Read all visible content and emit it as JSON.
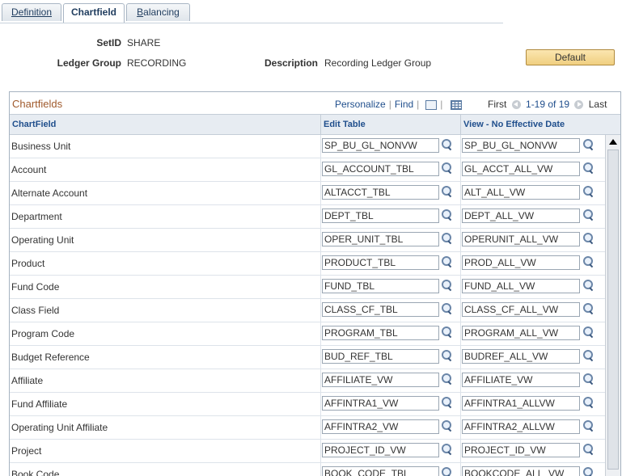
{
  "tabs": [
    {
      "label": "Definition",
      "active": false
    },
    {
      "label": "Chartfield",
      "active": true
    },
    {
      "label": "B",
      "label_rest": "alancing",
      "active": false
    }
  ],
  "header": {
    "setid_label": "SetID",
    "setid_value": "SHARE",
    "ledger_group_label": "Ledger Group",
    "ledger_group_value": "RECORDING",
    "description_label": "Description",
    "description_value": "Recording Ledger Group",
    "default_button": "Default"
  },
  "grid": {
    "title": "Chartfields",
    "personalize": "Personalize",
    "find": "Find",
    "first": "First",
    "count": "1-19 of 19",
    "last": "Last",
    "columns": [
      "ChartField",
      "Edit Table",
      "View - No Effective Date"
    ],
    "rows": [
      {
        "name": "Business Unit",
        "edit": "SP_BU_GL_NONVW",
        "view": "SP_BU_GL_NONVW"
      },
      {
        "name": "Account",
        "edit": "GL_ACCOUNT_TBL",
        "view": "GL_ACCT_ALL_VW"
      },
      {
        "name": "Alternate Account",
        "edit": "ALTACCT_TBL",
        "view": "ALT_ALL_VW"
      },
      {
        "name": "Department",
        "edit": "DEPT_TBL",
        "view": "DEPT_ALL_VW"
      },
      {
        "name": "Operating Unit",
        "edit": "OPER_UNIT_TBL",
        "view": "OPERUNIT_ALL_VW"
      },
      {
        "name": "Product",
        "edit": "PRODUCT_TBL",
        "view": "PROD_ALL_VW"
      },
      {
        "name": "Fund Code",
        "edit": "FUND_TBL",
        "view": "FUND_ALL_VW"
      },
      {
        "name": "Class Field",
        "edit": "CLASS_CF_TBL",
        "view": "CLASS_CF_ALL_VW"
      },
      {
        "name": "Program Code",
        "edit": "PROGRAM_TBL",
        "view": "PROGRAM_ALL_VW"
      },
      {
        "name": "Budget Reference",
        "edit": "BUD_REF_TBL",
        "view": "BUDREF_ALL_VW"
      },
      {
        "name": "Affiliate",
        "edit": "AFFILIATE_VW",
        "view": "AFFILIATE_VW"
      },
      {
        "name": "Fund Affiliate",
        "edit": "AFFINTRA1_VW",
        "view": "AFFINTRA1_ALLVW"
      },
      {
        "name": "Operating Unit Affiliate",
        "edit": "AFFINTRA2_VW",
        "view": "AFFINTRA2_ALLVW"
      },
      {
        "name": "Project",
        "edit": "PROJECT_ID_VW",
        "view": "PROJECT_ID_VW"
      },
      {
        "name": "Book Code",
        "edit": "BOOK_CODE_TBL",
        "view": "BOOKCODE_ALL_VW"
      }
    ]
  },
  "icons": {
    "lookup": "magnifier-lookup-icon",
    "view_all": "view-all-icon",
    "download": "download-grid-icon",
    "prev": "previous-arrow-icon",
    "next": "next-arrow-icon"
  }
}
